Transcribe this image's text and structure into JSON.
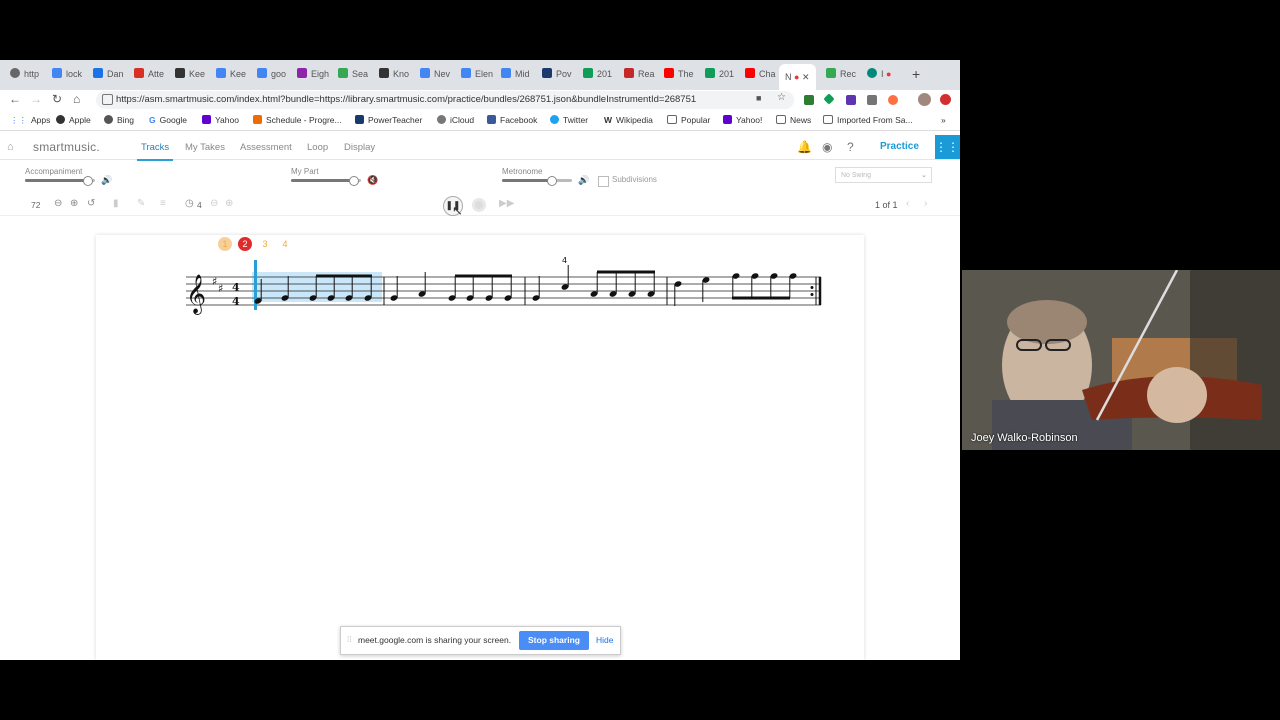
{
  "browser": {
    "tabs": [
      "http",
      "lock",
      "Dan",
      "Atte",
      "Kee",
      "Kee",
      "goo",
      "Eigh",
      "Sea",
      "Kno",
      "Nev",
      "Elen",
      "Mid",
      "Pov",
      "201",
      "Rea",
      "The",
      "201",
      "Cha",
      "N",
      "Rec",
      "I"
    ],
    "address": "https://asm.smartmusic.com/index.html?bundle=https://library.smartmusic.com/practice/bundles/268751.json&bundleInstrumentId=268751",
    "bookmarks": [
      "Apps",
      "Apple",
      "Bing",
      "Google",
      "Yahoo",
      "Schedule - Progre...",
      "PowerTeacher",
      "iCloud",
      "Facebook",
      "Twitter",
      "Wikipedia",
      "Popular",
      "Yahoo!",
      "News",
      "Imported From Sa..."
    ],
    "more_bookmarks": "»"
  },
  "app": {
    "logo": "smartmusic.",
    "nav": [
      "Tracks",
      "My Takes",
      "Assessment",
      "Loop",
      "Display"
    ],
    "practice_label": "Practice"
  },
  "mixer": {
    "accompaniment_label": "Accompaniment",
    "accompaniment_level": 0.88,
    "mypart_label": "My Part",
    "mypart_level": 0.88,
    "metronome_label": "Metronome",
    "metronome_level": 0.7,
    "subdivisions_label": "Subdivisions",
    "swing_placeholder": "No Swing"
  },
  "transport": {
    "tempo": "72",
    "countoff": "4",
    "page": "1 of 1"
  },
  "score": {
    "count_in": [
      "1",
      "2",
      "3",
      "4"
    ],
    "active_count": 2,
    "fingering": "4"
  },
  "banner": {
    "message": "meet.google.com is sharing your screen.",
    "stop": "Stop sharing",
    "hide": "Hide"
  },
  "video": {
    "name": "Joey Walko-Robinson"
  },
  "colors": {
    "accent": "#1a9bd7",
    "highlight": "#bfe3f7",
    "count_active": "#e02b2b",
    "count_idle": "#f2a93b"
  }
}
